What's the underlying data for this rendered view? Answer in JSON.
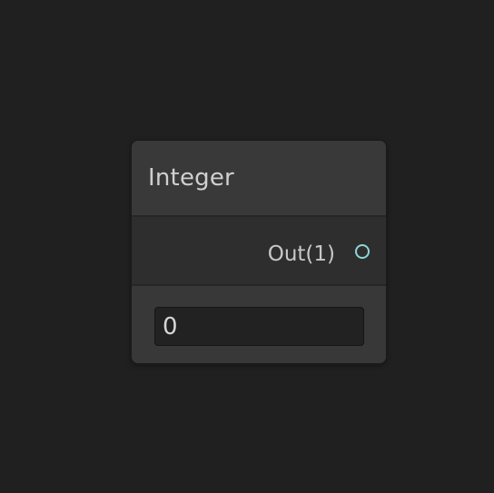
{
  "node": {
    "title": "Integer",
    "output_port": {
      "label": "Out(1)"
    },
    "value_field": {
      "value": "0"
    }
  },
  "colors": {
    "background": "#202020",
    "node_header": "#393939",
    "node_body": "#2e2e2e",
    "port_connector": "#8fd6d6",
    "text": "#d0d0d0"
  }
}
